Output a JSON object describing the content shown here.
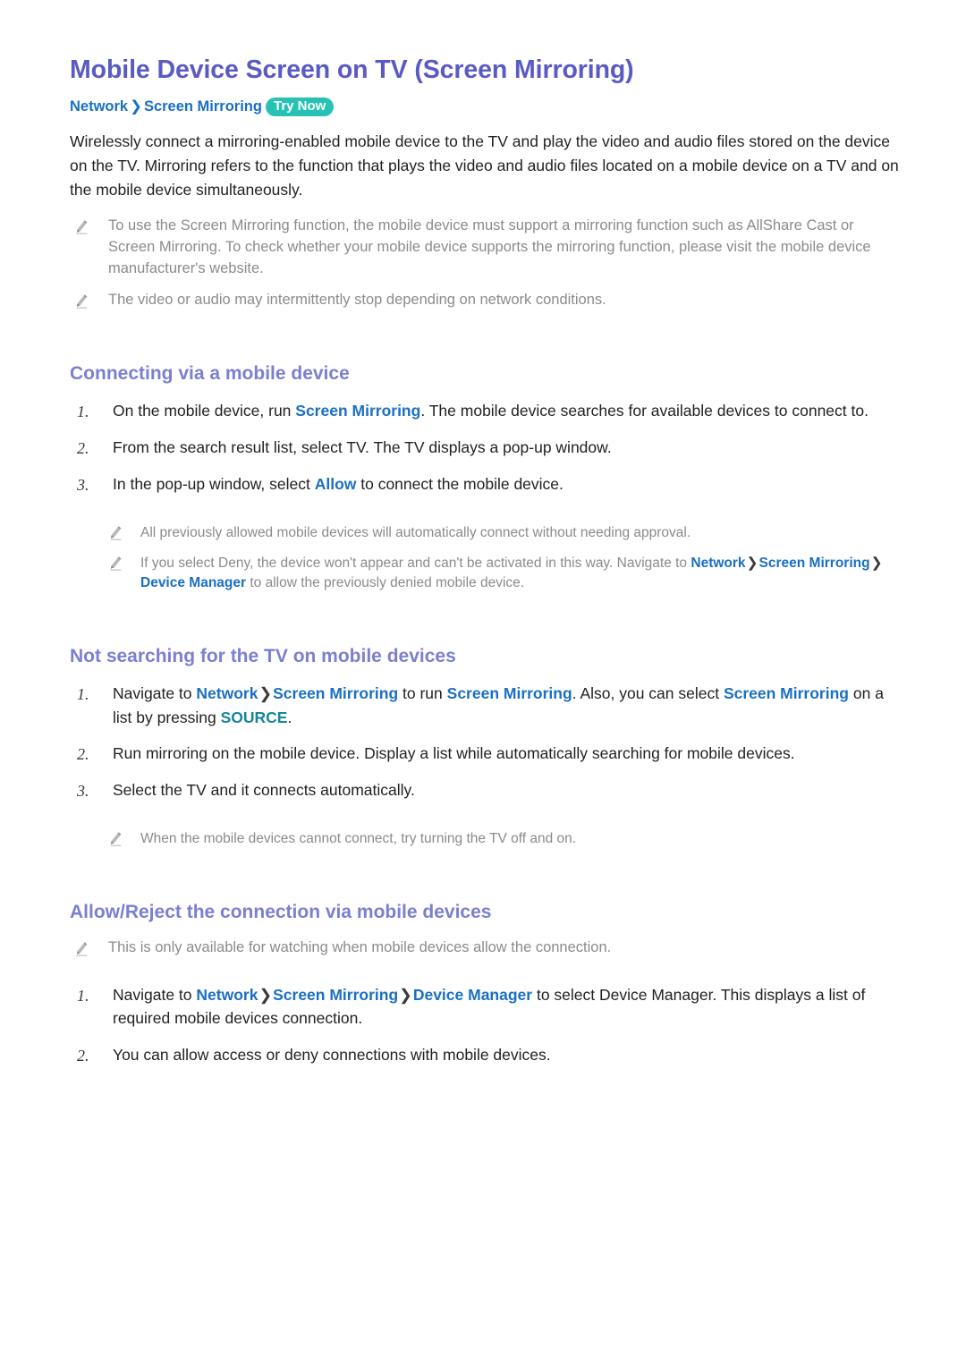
{
  "colors": {
    "title": "#5a5ac4",
    "section_heading": "#7b7fd0",
    "link": "#1a6fc4",
    "key": "#17859b",
    "badge_bg": "#28c2b4",
    "body_text": "#231f20",
    "note_text": "#8b8b90"
  },
  "page": {
    "title": "Mobile Device Screen on TV (Screen Mirroring)"
  },
  "breadcrumb": {
    "crumb1": "Network",
    "separator": "❯",
    "crumb2": "Screen Mirroring",
    "badge": "Try Now"
  },
  "intro": {
    "paragraph": "Wirelessly connect a mirroring-enabled mobile device to the TV and play the video and audio files stored on the device on the TV. Mirroring refers to the function that plays the video and audio files located on a mobile device on a TV and on the mobile device simultaneously."
  },
  "intro_notes": [
    {
      "text": "To use the Screen Mirroring function, the mobile device must support a mirroring function such as AllShare Cast or Screen Mirroring. To check whether your mobile device supports the mirroring function, please visit the mobile device manufacturer's website."
    },
    {
      "text": "The video or audio may intermittently stop depending on network conditions."
    }
  ],
  "sections": [
    {
      "heading": "Connecting via a mobile device",
      "steps": [
        {
          "num": "1.",
          "parts": [
            {
              "type": "text",
              "value": "On the mobile device, run "
            },
            {
              "type": "link",
              "value": "Screen Mirroring"
            },
            {
              "type": "text",
              "value": ". The mobile device searches for available devices to connect to."
            }
          ]
        },
        {
          "num": "2.",
          "parts": [
            {
              "type": "text",
              "value": "From the search result list, select TV. The TV displays a pop-up window."
            }
          ]
        },
        {
          "num": "3.",
          "parts": [
            {
              "type": "text",
              "value": "In the pop-up window, select "
            },
            {
              "type": "link",
              "value": "Allow"
            },
            {
              "type": "text",
              "value": " to connect the mobile device."
            }
          ]
        }
      ],
      "sub_notes": [
        {
          "parts": [
            {
              "type": "text",
              "value": "All previously allowed mobile devices will automatically connect without needing approval."
            }
          ]
        },
        {
          "parts": [
            {
              "type": "text",
              "value": "If you select Deny, the device won't appear and can't be activated in this way. Navigate to "
            },
            {
              "type": "link",
              "value": "Network"
            },
            {
              "type": "sep",
              "value": "❯"
            },
            {
              "type": "link",
              "value": "Screen Mirroring"
            },
            {
              "type": "sep",
              "value": "❯"
            },
            {
              "type": "link",
              "value": "Device Manager"
            },
            {
              "type": "text",
              "value": " to allow the previously denied mobile device."
            }
          ]
        }
      ]
    },
    {
      "heading": "Not searching for the TV on mobile devices",
      "steps": [
        {
          "num": "1.",
          "parts": [
            {
              "type": "text",
              "value": "Navigate to "
            },
            {
              "type": "link",
              "value": "Network"
            },
            {
              "type": "sep",
              "value": "❯"
            },
            {
              "type": "link",
              "value": "Screen Mirroring"
            },
            {
              "type": "text",
              "value": " to run "
            },
            {
              "type": "link",
              "value": "Screen Mirroring"
            },
            {
              "type": "text",
              "value": ". Also, you can select "
            },
            {
              "type": "link",
              "value": "Screen Mirroring"
            },
            {
              "type": "text",
              "value": " on a list by pressing "
            },
            {
              "type": "key",
              "value": "SOURCE"
            },
            {
              "type": "text",
              "value": "."
            }
          ]
        },
        {
          "num": "2.",
          "parts": [
            {
              "type": "text",
              "value": "Run mirroring on the mobile device. Display a list while automatically searching for mobile devices."
            }
          ]
        },
        {
          "num": "3.",
          "parts": [
            {
              "type": "text",
              "value": "Select the TV and it connects automatically."
            }
          ]
        }
      ],
      "sub_notes": [
        {
          "parts": [
            {
              "type": "text",
              "value": "When the mobile devices cannot connect, try turning the TV off and on."
            }
          ]
        }
      ]
    },
    {
      "heading": "Allow/Reject the connection via mobile devices",
      "lead_notes": [
        {
          "parts": [
            {
              "type": "text",
              "value": "This is only available for watching when mobile devices allow the connection."
            }
          ]
        }
      ],
      "steps": [
        {
          "num": "1.",
          "parts": [
            {
              "type": "text",
              "value": "Navigate to "
            },
            {
              "type": "link",
              "value": "Network"
            },
            {
              "type": "sep",
              "value": "❯"
            },
            {
              "type": "link",
              "value": "Screen Mirroring"
            },
            {
              "type": "sep",
              "value": "❯"
            },
            {
              "type": "link",
              "value": "Device Manager"
            },
            {
              "type": "text",
              "value": " to select Device Manager. This displays a list of required mobile devices connection."
            }
          ]
        },
        {
          "num": "2.",
          "parts": [
            {
              "type": "text",
              "value": "You can allow access or deny connections with mobile devices."
            }
          ]
        }
      ]
    }
  ],
  "icons": {
    "pencil": "pencil-icon"
  }
}
